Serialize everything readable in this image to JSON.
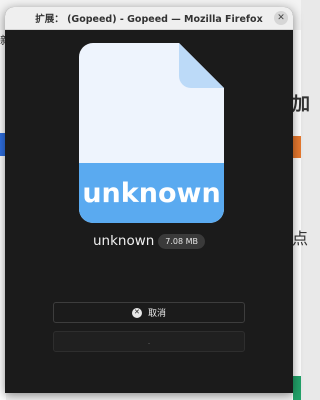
{
  "window": {
    "title": "扩展： (Gopeed) - Gopeed — Mozilla Firefox",
    "close_glyph": "✕"
  },
  "file": {
    "icon_label": "unknown",
    "name": "unknown",
    "size": "7.08 MB"
  },
  "actions": {
    "cancel_label": "取消",
    "cancel_icon_glyph": "✕",
    "second_label": "."
  },
  "background": {
    "left_chars": [
      "新"
    ],
    "right_chars": [
      "加",
      "点"
    ]
  },
  "colors": {
    "window_bg": "#1b1b1b",
    "icon_body": "#eef4fd",
    "icon_fold": "#bcdaf8",
    "icon_band": "#5aaaf0",
    "titlebar_bg": "#efefef"
  }
}
